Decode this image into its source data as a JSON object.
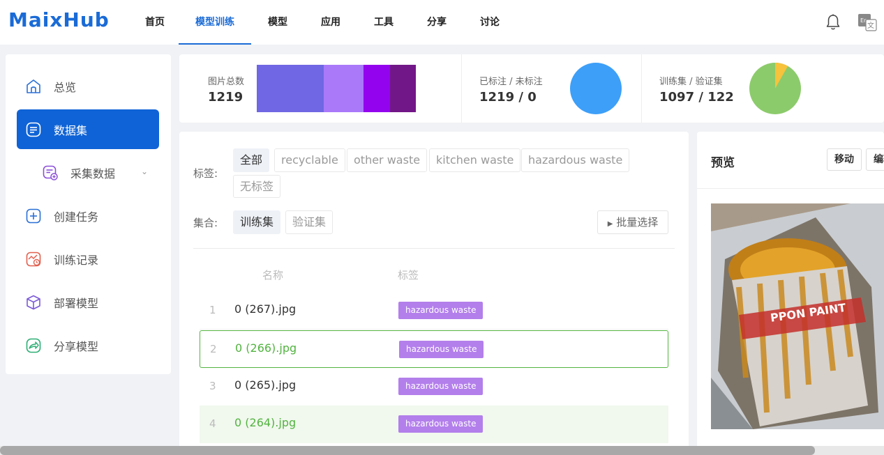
{
  "brand": "MaixHub",
  "nav": [
    {
      "label": "首页"
    },
    {
      "label": "模型训练",
      "active": true
    },
    {
      "label": "模型"
    },
    {
      "label": "应用"
    },
    {
      "label": "工具"
    },
    {
      "label": "分享"
    },
    {
      "label": "讨论"
    }
  ],
  "sidebar": {
    "items": [
      {
        "label": "总览",
        "icon": "home-icon"
      },
      {
        "label": "数据集",
        "icon": "dataset-icon",
        "active": true
      },
      {
        "label": "采集数据",
        "icon": "collect-data-icon",
        "sub": true
      },
      {
        "label": "创建任务",
        "icon": "plus-square-icon"
      },
      {
        "label": "训练记录",
        "icon": "train-record-icon"
      },
      {
        "label": "部署模型",
        "icon": "cube-icon"
      },
      {
        "label": "分享模型",
        "icon": "share-icon"
      }
    ]
  },
  "stats": {
    "total": {
      "label": "图片总数",
      "value": "1219"
    },
    "labeled": {
      "label": "已标注 / 未标注",
      "value": "1219 / 0"
    },
    "split": {
      "label": "训练集 / 验证集",
      "value": "1097 / 122"
    }
  },
  "colors": {
    "accent": "#1a6bd6",
    "bar_segments": [
      "#6f67e3",
      "#a979fa",
      "#9403ee",
      "#721787"
    ],
    "labeled_pie": "#3d9ff8",
    "split_pie_train": "#8ccb6b",
    "split_pie_val": "#f7c23c",
    "badge": "#b37feb",
    "selected": "#52b340"
  },
  "filters": {
    "tags_label": "标签:",
    "tags": [
      "全部",
      "recyclable",
      "other waste",
      "kitchen waste",
      "hazardous waste",
      "无标签"
    ],
    "set_label": "集合:",
    "sets": [
      "训练集",
      "验证集"
    ],
    "batch_select": "批量选择"
  },
  "table": {
    "headers": {
      "name": "名称",
      "tag": "标签"
    },
    "rows": [
      {
        "index": "1",
        "name": "0 (267).jpg",
        "tag": "hazardous waste"
      },
      {
        "index": "2",
        "name": "0 (266).jpg",
        "tag": "hazardous waste"
      },
      {
        "index": "3",
        "name": "0 (265).jpg",
        "tag": "hazardous waste"
      },
      {
        "index": "4",
        "name": "0 (264).jpg",
        "tag": "hazardous waste"
      }
    ]
  },
  "preview": {
    "title": "预览",
    "move_button": "移动",
    "edit_button": "编辑"
  }
}
